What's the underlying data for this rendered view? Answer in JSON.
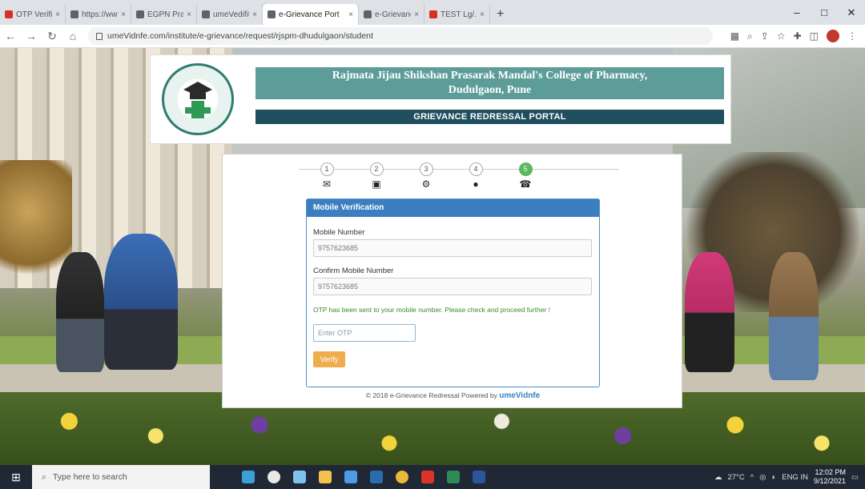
{
  "browser": {
    "tabs": [
      {
        "label": "OTP Verificati...",
        "active": false,
        "favicon_color": "#d93025"
      },
      {
        "label": "https://www.w...",
        "active": false,
        "favicon_color": "#5f6368"
      },
      {
        "label": "EGPN Prakhar...",
        "active": false,
        "favicon_color": "#5f6368"
      },
      {
        "label": "umeVedifit Upmi",
        "active": false,
        "favicon_color": "#5f6368"
      },
      {
        "label": "e-Grievance Port",
        "active": true,
        "favicon_color": "#5f6368"
      },
      {
        "label": "e-Grievance Re...",
        "active": false,
        "favicon_color": "#5f6368"
      },
      {
        "label": "TEST Lg/...",
        "active": false,
        "favicon_color": "#d93025"
      }
    ],
    "url": "umeVidnfe.com/institute/e-grievance/request/rjspm-dhudulgaon/student"
  },
  "header": {
    "college_line1": "Rajmata Jijau Shikshan Prasarak Mandal's College of Pharmacy,",
    "college_line2": "Dudulgaon, Pune",
    "portal_title": "GRIEVANCE REDRESSAL PORTAL"
  },
  "steps": [
    {
      "num": "1",
      "icon": "envelope-icon",
      "glyph": "✉",
      "done": false
    },
    {
      "num": "2",
      "icon": "id-card-icon",
      "glyph": "▣",
      "done": false
    },
    {
      "num": "3",
      "icon": "gears-icon",
      "glyph": "⚙",
      "done": false
    },
    {
      "num": "4",
      "icon": "comment-icon",
      "glyph": "●",
      "done": false
    },
    {
      "num": "5",
      "icon": "phone-icon",
      "glyph": "☎",
      "done": true
    }
  ],
  "form": {
    "panel_title": "Mobile Verification",
    "mobile_label": "Mobile Number",
    "mobile_value": "9757623685",
    "confirm_label": "Confirm Mobile Number",
    "confirm_value": "9757623685",
    "otp_message": "OTP has been sent to your mobile number. Please check and proceed further !",
    "otp_placeholder": "Enter OTP",
    "verify_label": "Verify"
  },
  "footer": {
    "text": "© 2018 e-Grievance Redressal Powered by",
    "brand": "umeVidnfe"
  },
  "taskbar": {
    "search_placeholder": "Type here to search",
    "weather": "27°C",
    "lang": "ENG IN",
    "time": "12:02 PM",
    "date": "9/12/2021"
  }
}
